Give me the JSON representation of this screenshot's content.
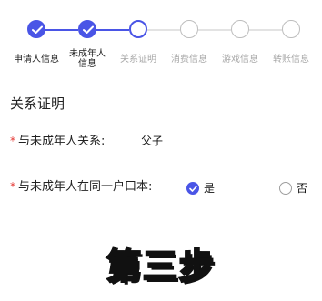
{
  "stepper": {
    "steps": [
      {
        "label": "申请人信息",
        "status": "done"
      },
      {
        "label": "未成年人\n信息",
        "status": "done"
      },
      {
        "label": "关系证明",
        "status": "current"
      },
      {
        "label": "消费信息",
        "status": "pending"
      },
      {
        "label": "游戏信息",
        "status": "pending"
      },
      {
        "label": "转账信息",
        "status": "pending"
      }
    ]
  },
  "section": {
    "title": "关系证明"
  },
  "form": {
    "required_mark": "*",
    "relation": {
      "label": "与未成年人关系:",
      "value": "父子"
    },
    "same_household": {
      "label": "与未成年人在同一户口本:",
      "options": [
        {
          "label": "是",
          "checked": true
        },
        {
          "label": "否",
          "checked": false
        }
      ]
    }
  },
  "caption": {
    "text": "第三步"
  },
  "colors": {
    "accent": "#4a55e6",
    "required": "#e53935",
    "pending": "#bdbdbd"
  }
}
